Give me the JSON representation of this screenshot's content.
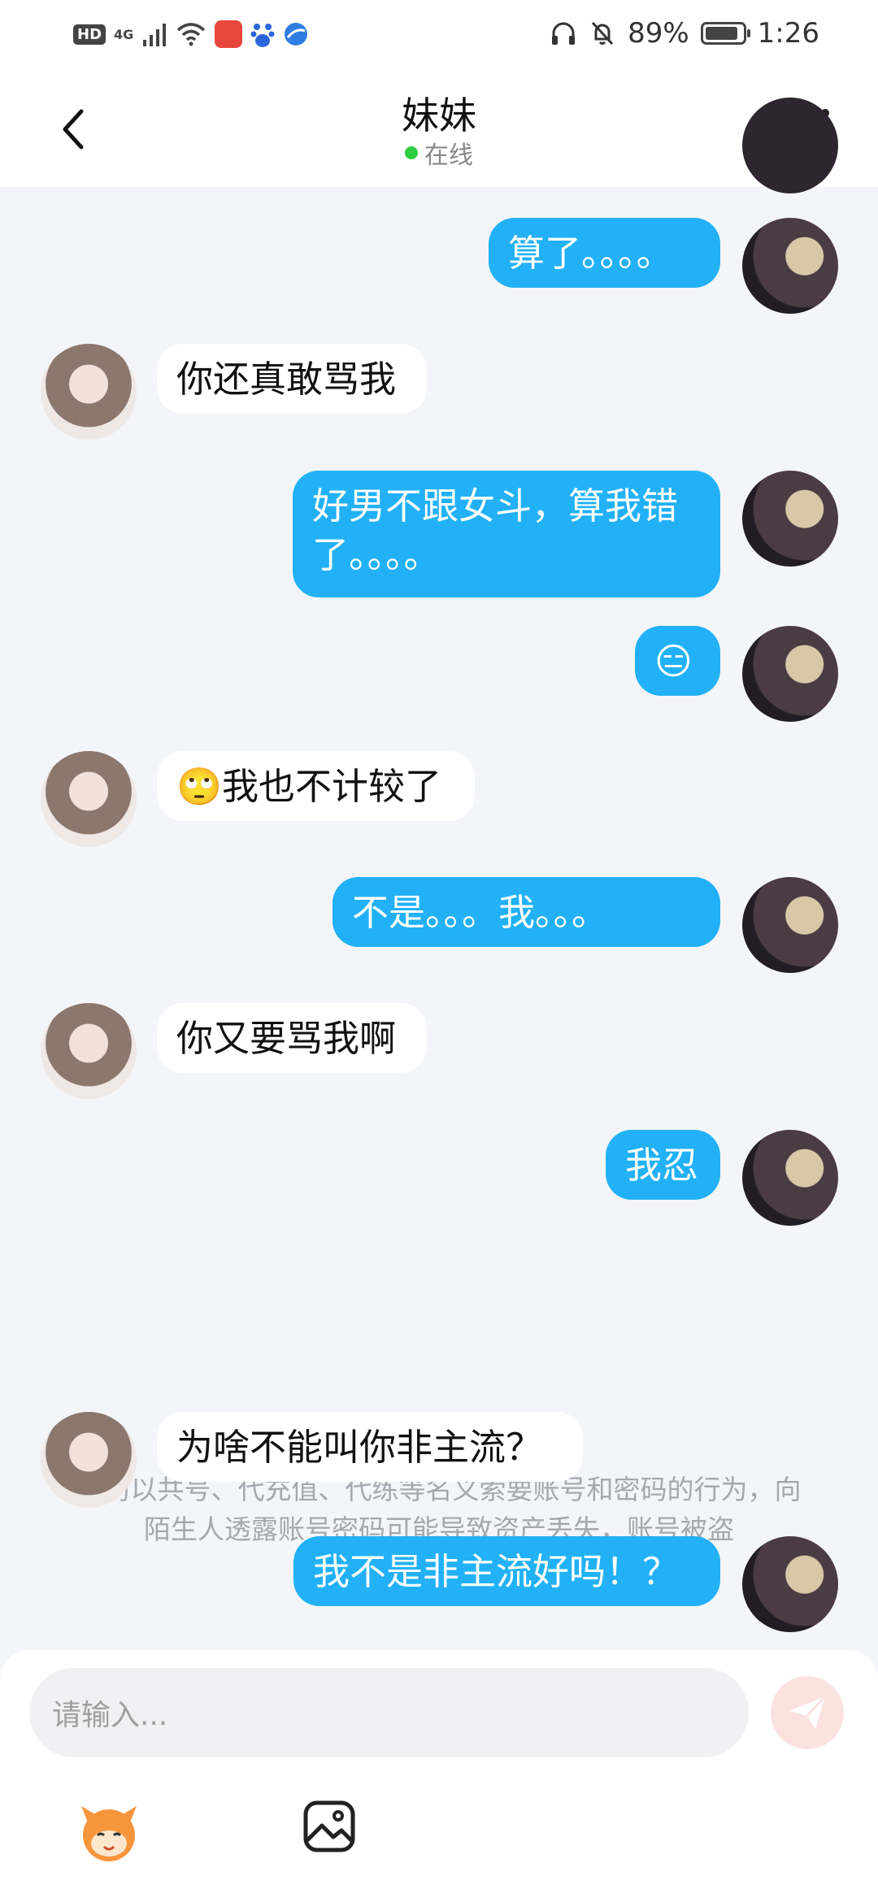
{
  "status_bar": {
    "hd": "HD",
    "network": "4G",
    "battery": "89%",
    "battery_level": 0.89,
    "time": "1:26"
  },
  "header": {
    "title": "妹妹",
    "status": "在线"
  },
  "messages": [
    {
      "from": "me",
      "text": "算了。。。。"
    },
    {
      "from": "them",
      "text": "你还真敢骂我"
    },
    {
      "from": "me",
      "text": "好男不跟女斗，算我错了。。。。"
    },
    {
      "from": "me",
      "text": "😑"
    },
    {
      "from": "them",
      "text": "🙄我也不计较了"
    },
    {
      "from": "me",
      "text": "不是。。。我。。。"
    },
    {
      "from": "them",
      "text": "你又要骂我啊"
    },
    {
      "from": "me",
      "text": "我忍"
    },
    {
      "from": "them",
      "text": "为啥不能叫你非主流？"
    },
    {
      "from": "me",
      "text": "我不是非主流好吗！？"
    }
  ],
  "notice": "谨防以共号、代充值、代练等名义索要账号和密码的行为，向陌生人透露账号密码可能导致资产丢失，账号被盗",
  "input": {
    "placeholder": "请输入..."
  },
  "colors": {
    "outgoing_bubble": "#22b1f6",
    "incoming_bubble": "#ffffff",
    "online_dot": "#2ecc40",
    "send_button": "#fbe2df"
  }
}
